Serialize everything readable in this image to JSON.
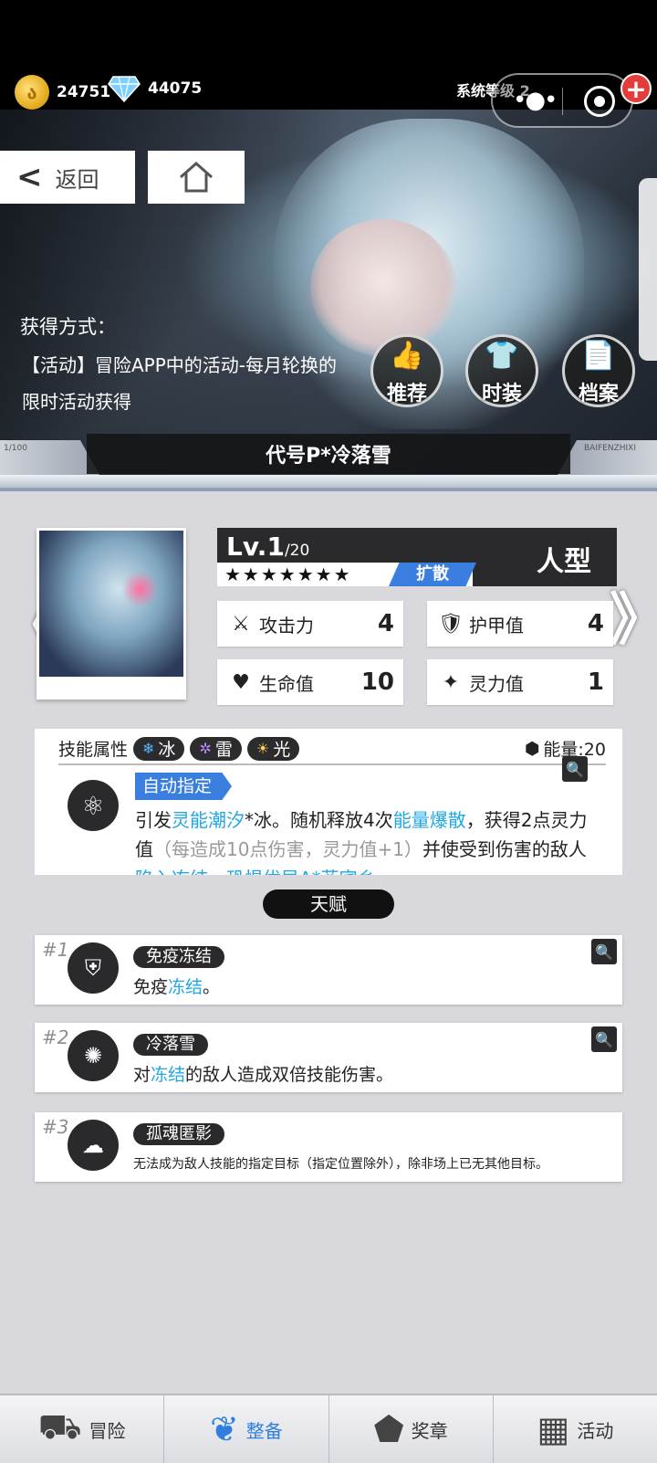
{
  "currency": {
    "coins": "24751",
    "diamonds": "44075"
  },
  "system_level": "系统等级 2",
  "hero": {
    "back_label": "返回",
    "obtain_title": "获得方式：",
    "obtain_desc": "【活动】冒险APP中的活动-每月轮换的限时活动获得",
    "actions": [
      "推荐",
      "时装",
      "档案"
    ],
    "character_name": "代号P*冷落雪",
    "deco_left": "1/100",
    "deco_right": "BAIFENZHIXI"
  },
  "character": {
    "level": "Lv.1",
    "level_max": "/20",
    "stars": "★★★★★★★",
    "trait": "扩散",
    "type": "人型",
    "stats": [
      {
        "label": "攻击力",
        "value": "4"
      },
      {
        "label": "护甲值",
        "value": "4"
      },
      {
        "label": "生命值",
        "value": "10"
      },
      {
        "label": "灵力值",
        "value": "1"
      }
    ]
  },
  "skill": {
    "attr_label": "技能属性",
    "elements": [
      "冰",
      "雷",
      "光"
    ],
    "energy": "能量:20",
    "auto_tag": "自动指定",
    "desc_1": "引发",
    "desc_hl1": "灵能潮汐",
    "desc_2": "*冰。随机释放4次",
    "desc_hl2": "能量爆散",
    "desc_3": "，获得2点灵力值",
    "desc_gray": "（每造成10点伤害，灵力值+1）",
    "desc_4": "并使受到伤害的敌人",
    "desc_cut": "陷入冻结、恐惧优异A*菲宾乡"
  },
  "talents": {
    "title": "天赋",
    "items": [
      {
        "num": "#1",
        "name": "免疫冻结",
        "desc_pre": "免疫",
        "desc_hl": "冻结",
        "desc_post": "。"
      },
      {
        "num": "#2",
        "name": "冷落雪",
        "desc_pre": "对",
        "desc_hl": "冻结",
        "desc_post": "的敌人造成双倍技能伤害。"
      },
      {
        "num": "#3",
        "name": "孤魂匿影",
        "desc_pre": "无法成为敌人技能的指定目标（指定位置除外），除非场上已无其他目标。",
        "desc_hl": "",
        "desc_post": ""
      }
    ]
  },
  "nav": [
    "冒险",
    "整备",
    "奖章",
    "活动"
  ],
  "colors": {
    "accent": "#3a7fe0",
    "highlight": "#1fa7e6",
    "active_nav": "#2e7fe0"
  }
}
